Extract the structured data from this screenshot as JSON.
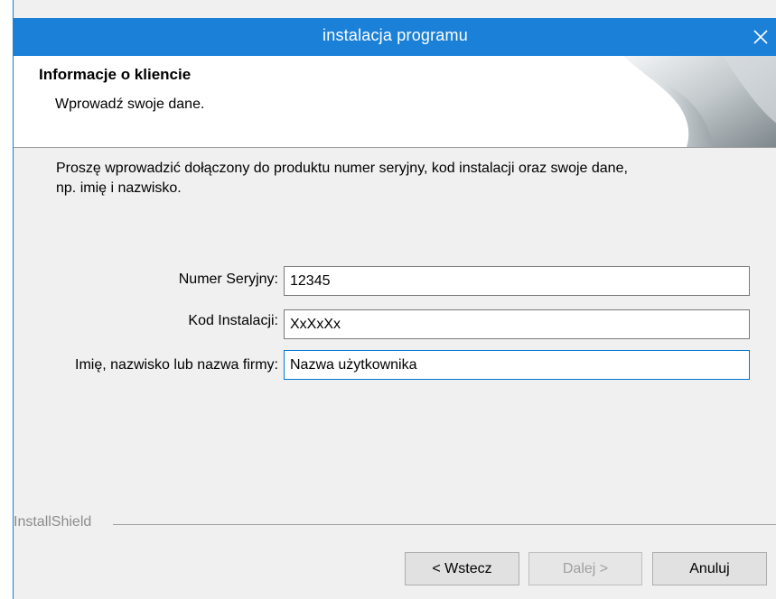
{
  "window": {
    "title": "instalacja programu"
  },
  "header": {
    "title": "Informacje o kliencie",
    "subtitle": "Wprowadź swoje dane."
  },
  "intro": {
    "line1": "Proszę wprowadzić dołączony do produktu numer seryjny, kod instalacji oraz swoje dane,",
    "line2": "np. imię i nazwisko."
  },
  "form": {
    "serial": {
      "label": "Numer Seryjny:",
      "value": "12345"
    },
    "install_code": {
      "label": "Kod Instalacji:",
      "value": "XxXxXx"
    },
    "name": {
      "label": "Imię, nazwisko lub nazwa firmy:",
      "value": "Nazwa użytkownika"
    }
  },
  "footer": {
    "brand": "InstallShield",
    "back_label": "< Wstecz",
    "next_label": "Dalej >",
    "cancel_label": "Anuluj"
  },
  "icons": {
    "close": "close-icon",
    "header_graphic": "page-curl-graphic"
  },
  "colors": {
    "titlebar": "#1b80d8",
    "focus_border": "#0078d7",
    "dialog_bg": "#f0f0f0"
  }
}
